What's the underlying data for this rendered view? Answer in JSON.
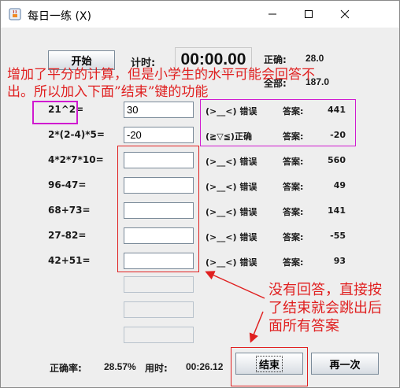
{
  "window": {
    "title": "每日一练 (X)"
  },
  "header": {
    "start_button": "开始",
    "timer_label": "计时:",
    "timer_value": "00:00.00",
    "correct_label": "正确:",
    "correct_value": "28.0",
    "total_label": "全部:",
    "total_value": "187.0"
  },
  "questions": [
    {
      "text": "21^2=",
      "answer": "30",
      "result": "(>__<) 错误",
      "ans_label": "答案:",
      "ans_value": "441"
    },
    {
      "text": "2*(2-4)*5=",
      "answer": "-20",
      "result": "(≧▽≦)正确",
      "ans_label": "答案:",
      "ans_value": "-20"
    },
    {
      "text": "4*2*7*10=",
      "answer": "",
      "result": "(>__<) 错误",
      "ans_label": "答案:",
      "ans_value": "560"
    },
    {
      "text": "96-47=",
      "answer": "",
      "result": "(>__<) 错误",
      "ans_label": "答案:",
      "ans_value": "49"
    },
    {
      "text": "68+73=",
      "answer": "",
      "result": "(>__<) 错误",
      "ans_label": "答案:",
      "ans_value": "141"
    },
    {
      "text": "27-82=",
      "answer": "",
      "result": "(>__<) 错误",
      "ans_label": "答案:",
      "ans_value": "-55"
    },
    {
      "text": "42+51=",
      "answer": "",
      "result": "(>__<) 错误",
      "ans_label": "答案:",
      "ans_value": "93"
    }
  ],
  "footer": {
    "accuracy_label": "正确率:",
    "accuracy_value": "28.57%",
    "time_label": "用时:",
    "time_value": "00:26.12",
    "end_button": "结束",
    "again_button": "再一次"
  },
  "annotations": {
    "top_note_line1": "增加了平分的计算，但是小学生的水平可能会回答不",
    "top_note_line2": "出。所以加入下面”结束”键的功能",
    "side_note_line1": "没有回答，直接按",
    "side_note_line2": "了结束就会跳出后",
    "side_note_line3": "面所有答案",
    "highlight_color": "#d01ad0",
    "note_color": "#e02020"
  }
}
